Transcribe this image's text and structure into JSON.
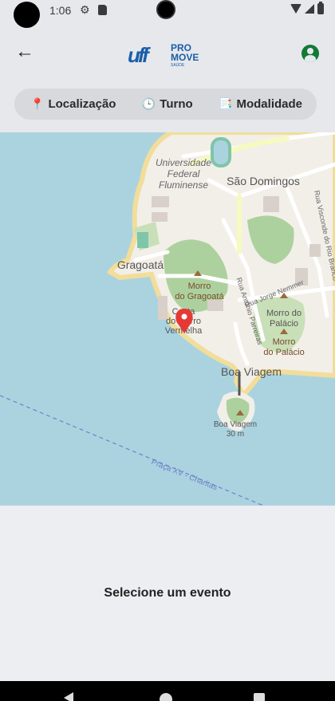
{
  "status_bar": {
    "time": "1:06"
  },
  "app_bar": {
    "logo": {
      "brand": "uff",
      "line1": "PRO",
      "line2": "MOVE",
      "line3": "SAÚDE"
    }
  },
  "filters": [
    {
      "icon": "📍",
      "label": "Localização"
    },
    {
      "icon": "🕒",
      "label": "Turno"
    },
    {
      "icon": "📑",
      "label": "Modalidade"
    }
  ],
  "map": {
    "labels": {
      "university1": "Universidade",
      "university2": "Federal",
      "university3": "Fluminense",
      "sao_domingos": "São Domingos",
      "gragoata": "Gragoatá",
      "morro_gragoata1": "Morro",
      "morro_gragoata2": "do Gragoatá",
      "morro_palacio1": "Morro do",
      "morro_palacio2": "Palácio",
      "morro_palacio3": "Morro",
      "morro_palacio4": "do Palácio",
      "rua_antonio": "Rua Antônio Parreiras",
      "rua_nemmer": "Rua Jorge Nemmer",
      "rua_visconde": "Rua Visconde do Rio Branco",
      "boa_viagem": "Boa Viagem",
      "boa_viagem_hill1": "Boa Viagem",
      "boa_viagem_hill2": "30 m",
      "ferry": "Praça XV - Charitas",
      "costa1": "Costa",
      "costa2": "do Morro",
      "costa3": "Vermelha"
    },
    "accent_pin": "#e53935"
  },
  "sheet": {
    "empty_message": "Selecione um evento"
  }
}
